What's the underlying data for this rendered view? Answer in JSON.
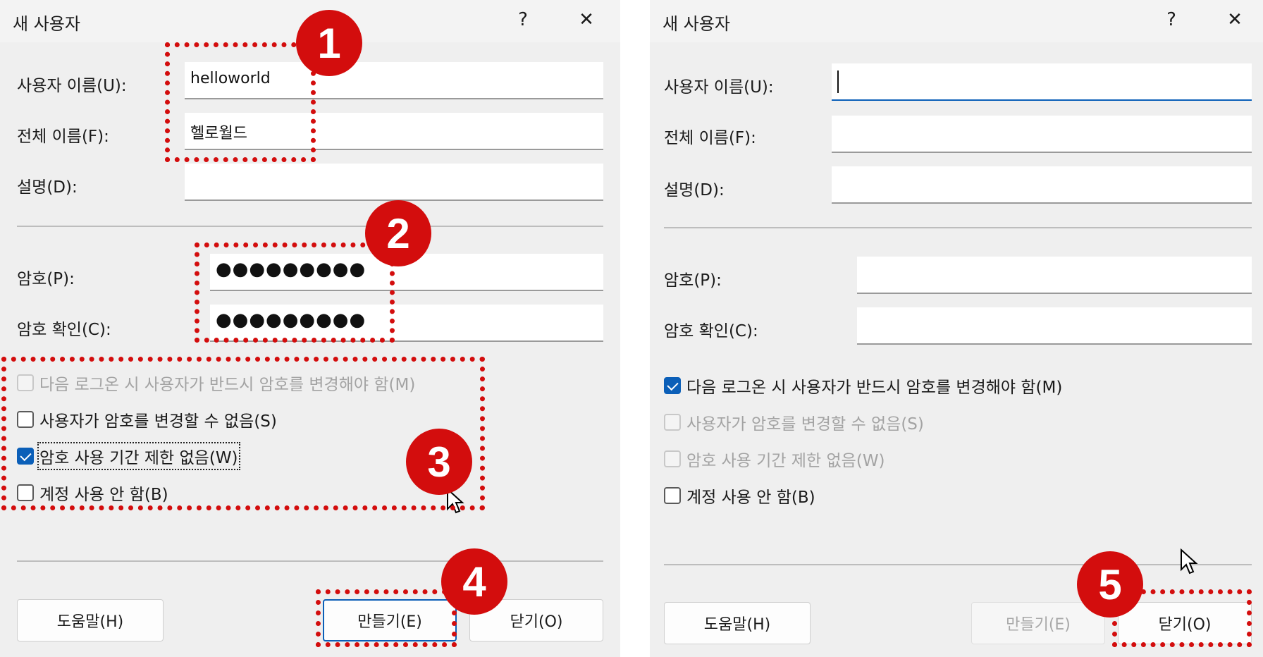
{
  "left": {
    "title": "새 사용자",
    "help_glyph": "?",
    "close_glyph": "✕",
    "labels": {
      "username": "사용자 이름(U):",
      "fullname": "전체 이름(F):",
      "description": "설명(D):",
      "password": "암호(P):",
      "confirm": "암호 확인(C):"
    },
    "values": {
      "username": "helloworld",
      "fullname": "헬로월드",
      "description": "",
      "password": "●●●●●●●●●",
      "confirm": "●●●●●●●●●"
    },
    "checkboxes": [
      {
        "label": "다음 로그온 시 사용자가 반드시 암호를 변경해야 함(M)",
        "checked": false,
        "disabled": true
      },
      {
        "label": "사용자가 암호를 변경할 수 없음(S)",
        "checked": false,
        "disabled": false
      },
      {
        "label": "암호 사용 기간 제한 없음(W)",
        "checked": true,
        "disabled": false
      },
      {
        "label": "계정 사용 안 함(B)",
        "checked": false,
        "disabled": false
      }
    ],
    "buttons": {
      "help": "도움말(H)",
      "create": "만들기(E)",
      "close": "닫기(O)"
    }
  },
  "right": {
    "title": "새 사용자",
    "help_glyph": "?",
    "close_glyph": "✕",
    "labels": {
      "username": "사용자 이름(U):",
      "fullname": "전체 이름(F):",
      "description": "설명(D):",
      "password": "암호(P):",
      "confirm": "암호 확인(C):"
    },
    "values": {
      "username": "",
      "fullname": "",
      "description": "",
      "password": "",
      "confirm": ""
    },
    "checkboxes": [
      {
        "label": "다음 로그온 시 사용자가 반드시 암호를 변경해야 함(M)",
        "checked": true,
        "disabled": false
      },
      {
        "label": "사용자가 암호를 변경할 수 없음(S)",
        "checked": false,
        "disabled": true
      },
      {
        "label": "암호 사용 기간 제한 없음(W)",
        "checked": false,
        "disabled": true
      },
      {
        "label": "계정 사용 안 함(B)",
        "checked": false,
        "disabled": false
      }
    ],
    "buttons": {
      "help": "도움말(H)",
      "create": "만들기(E)",
      "close": "닫기(O)"
    }
  },
  "annotations": {
    "badges": [
      "1",
      "2",
      "3",
      "4",
      "5"
    ],
    "color": "#d30d0d"
  },
  "colors": {
    "accent": "#0b5fb8",
    "dialog_bg": "#efefef"
  }
}
